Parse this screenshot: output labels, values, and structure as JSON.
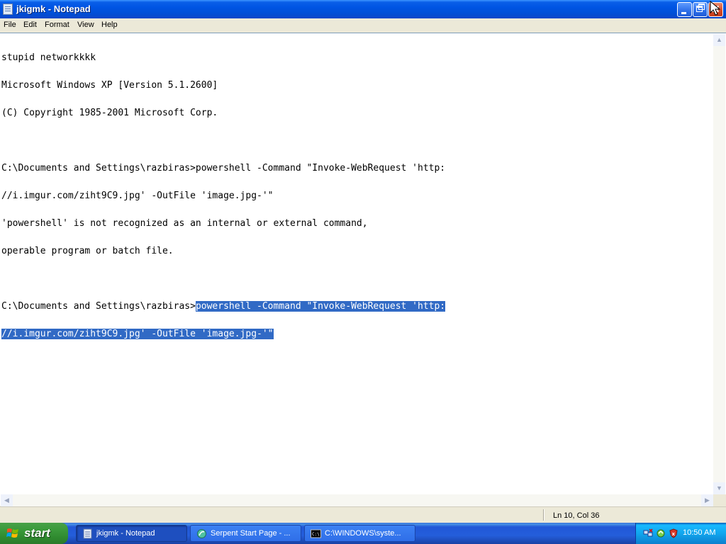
{
  "window": {
    "title": "jkigmk - Notepad"
  },
  "menubar": {
    "items": [
      "File",
      "Edit",
      "Format",
      "View",
      "Help"
    ]
  },
  "editor": {
    "lines": [
      "stupid networkkkk",
      "Microsoft Windows XP [Version 5.1.2600]",
      "(C) Copyright 1985-2001 Microsoft Corp.",
      "",
      "C:\\Documents and Settings\\razbiras>powershell -Command \"Invoke-WebRequest 'http:",
      "//i.imgur.com/ziht9C9.jpg' -OutFile 'image.jpg-'\"",
      "'powershell' is not recognized as an internal or external command,",
      "operable program or batch file.",
      "",
      "C:\\Documents and Settings\\razbiras>"
    ],
    "selected_line_a": "powershell -Command \"Invoke-WebRequest 'http:",
    "selected_line_b": "//i.imgur.com/ziht9C9.jpg' -OutFile 'image.jpg-'\""
  },
  "statusbar": {
    "position": "Ln 10, Col 36"
  },
  "taskbar": {
    "start_label": "start",
    "tasks": [
      {
        "label": "jkigmk - Notepad",
        "icon": "notepad-icon",
        "active": true
      },
      {
        "label": "Serpent Start Page - ...",
        "icon": "browser-icon",
        "active": false
      },
      {
        "label": "C:\\WINDOWS\\syste...",
        "icon": "cmd-icon",
        "active": false
      }
    ],
    "clock": "10:50 AM"
  },
  "colors": {
    "selection": "#316ac5",
    "titlebar": "#0054e3",
    "start": "#3c9b3c"
  }
}
